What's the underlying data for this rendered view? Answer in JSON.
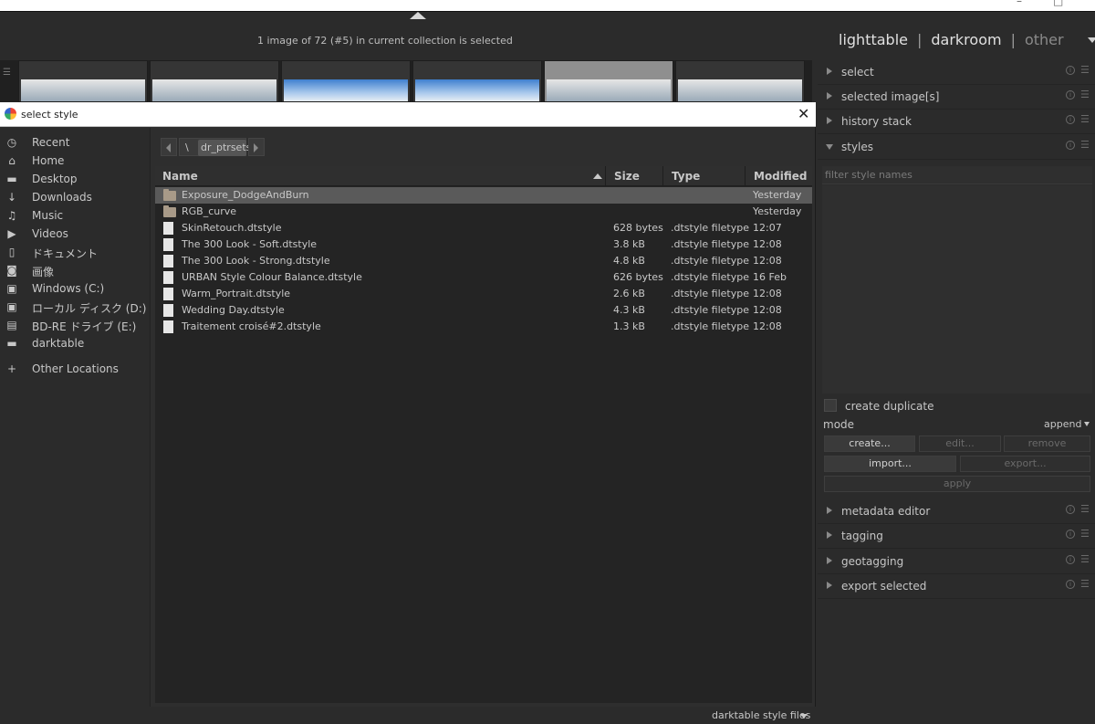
{
  "header": {
    "status": "1 image of 72 (#5) in current collection is selected",
    "views": {
      "lighttable": "lighttable",
      "darkroom": "darkroom",
      "other": "other",
      "separator": "|"
    }
  },
  "right_panel": {
    "modules_top": [
      {
        "label": "select"
      },
      {
        "label": "selected image[s]"
      },
      {
        "label": "history stack"
      },
      {
        "label": "styles"
      }
    ],
    "styles": {
      "filter_placeholder": "filter style names",
      "create_duplicate": "create duplicate",
      "mode_label": "mode",
      "mode_value": "append",
      "buttons": {
        "create": "create...",
        "edit": "edit...",
        "remove": "remove",
        "import": "import...",
        "export": "export...",
        "apply": "apply"
      }
    },
    "modules_bottom": [
      {
        "label": "metadata editor"
      },
      {
        "label": "tagging"
      },
      {
        "label": "geotagging"
      },
      {
        "label": "export selected"
      }
    ]
  },
  "dialog": {
    "title": "select style",
    "places": [
      {
        "label": "Recent",
        "icon": "clock-icon"
      },
      {
        "label": "Home",
        "icon": "home-icon"
      },
      {
        "label": "Desktop",
        "icon": "folder-icon"
      },
      {
        "label": "Downloads",
        "icon": "download-icon"
      },
      {
        "label": "Music",
        "icon": "music-icon"
      },
      {
        "label": "Videos",
        "icon": "video-icon"
      },
      {
        "label": "ドキュメント",
        "icon": "document-icon"
      },
      {
        "label": "画像",
        "icon": "camera-icon"
      },
      {
        "label": "Windows (C:)",
        "icon": "drive-icon"
      },
      {
        "label": "ローカル ディスク (D:)",
        "icon": "drive-icon"
      },
      {
        "label": "BD-RE ドライブ (E:)",
        "icon": "optical-drive-icon"
      },
      {
        "label": "darktable",
        "icon": "folder-icon"
      }
    ],
    "other_locations": "Other Locations",
    "path": {
      "root": "\\",
      "current": "dr_ptrsets"
    },
    "columns": {
      "name": "Name",
      "size": "Size",
      "type": "Type",
      "modified": "Modified"
    },
    "files": [
      {
        "name": "Exposure_DodgeAndBurn",
        "size": "",
        "type": "",
        "modified": "Yesterday",
        "kind": "folder"
      },
      {
        "name": "RGB_curve",
        "size": "",
        "type": "",
        "modified": "Yesterday",
        "kind": "folder"
      },
      {
        "name": "SkinRetouch.dtstyle",
        "size": "628 bytes",
        "type": ".dtstyle filetype",
        "modified": "12:07",
        "kind": "file"
      },
      {
        "name": "The 300 Look - Soft.dtstyle",
        "size": "3.8 kB",
        "type": ".dtstyle filetype",
        "modified": "12:08",
        "kind": "file"
      },
      {
        "name": "The 300 Look - Strong.dtstyle",
        "size": "4.8 kB",
        "type": ".dtstyle filetype",
        "modified": "12:08",
        "kind": "file"
      },
      {
        "name": "URBAN Style Colour Balance.dtstyle",
        "size": "626 bytes",
        "type": ".dtstyle filetype",
        "modified": "16 Feb",
        "kind": "file"
      },
      {
        "name": "Warm_Portrait.dtstyle",
        "size": "2.6 kB",
        "type": ".dtstyle filetype",
        "modified": "12:08",
        "kind": "file"
      },
      {
        "name": "Wedding Day.dtstyle",
        "size": "4.3 kB",
        "type": ".dtstyle filetype",
        "modified": "12:08",
        "kind": "file"
      },
      {
        "name": "Traitement croisé#2.dtstyle",
        "size": "1.3 kB",
        "type": ".dtstyle filetype",
        "modified": "12:08",
        "kind": "file"
      }
    ],
    "filter": "darktable style files"
  }
}
